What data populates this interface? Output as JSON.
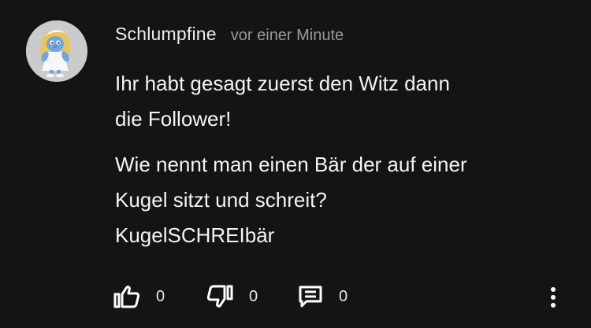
{
  "comment": {
    "avatar_icon": "smurfette-avatar",
    "author": "Schlumpfine",
    "timestamp": "vor einer Minute",
    "paragraphs": [
      "Ihr habt gesagt zuerst den Witz dann\ndie Follower!",
      "Wie nennt man einen Bär der auf einer\nKugel sitzt und schreit?\nKugelSCHREIbär"
    ]
  },
  "actions": {
    "like_icon": "thumbs-up-icon",
    "like_count": "0",
    "dislike_icon": "thumbs-down-icon",
    "dislike_count": "0",
    "reply_icon": "comment-icon",
    "reply_count": "0",
    "more_icon": "more-vertical-icon"
  },
  "colors": {
    "background": "#141416",
    "text": "#f4f4f4",
    "muted": "#9a9a9d"
  }
}
